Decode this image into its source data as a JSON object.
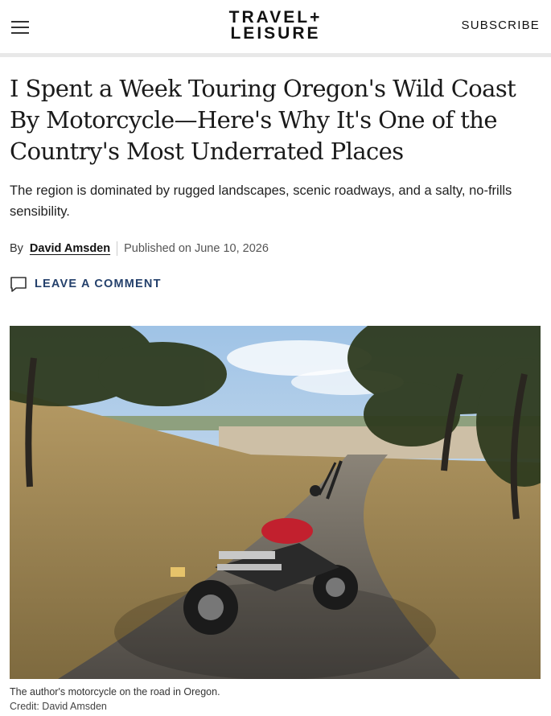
{
  "header": {
    "logo_line1": "TRAVEL+",
    "logo_line2": "LEISURE",
    "subscribe_label": "SUBSCRIBE",
    "menu_icon": "hamburger-menu-icon"
  },
  "article": {
    "headline": "I Spent a Week Touring Oregon's Wild Coast By Motorcycle—Here's Why It's One of the Country's Most Underrated Places",
    "dek": "The region is dominated by rugged landscapes, scenic roadways, and a salty, no-frills sensibility.",
    "byline": {
      "by_label": "By",
      "author": "David Amsden",
      "published": "Published on June 10, 2026"
    },
    "comment_label": "LEAVE A COMMENT",
    "comment_icon": "comment-bubble-icon",
    "hero": {
      "caption": "The author's motorcycle on the road in Oregon.",
      "credit": "Credit: David Amsden"
    }
  },
  "colors": {
    "accent_link": "#24406b",
    "divider": "#e8e8e8"
  }
}
